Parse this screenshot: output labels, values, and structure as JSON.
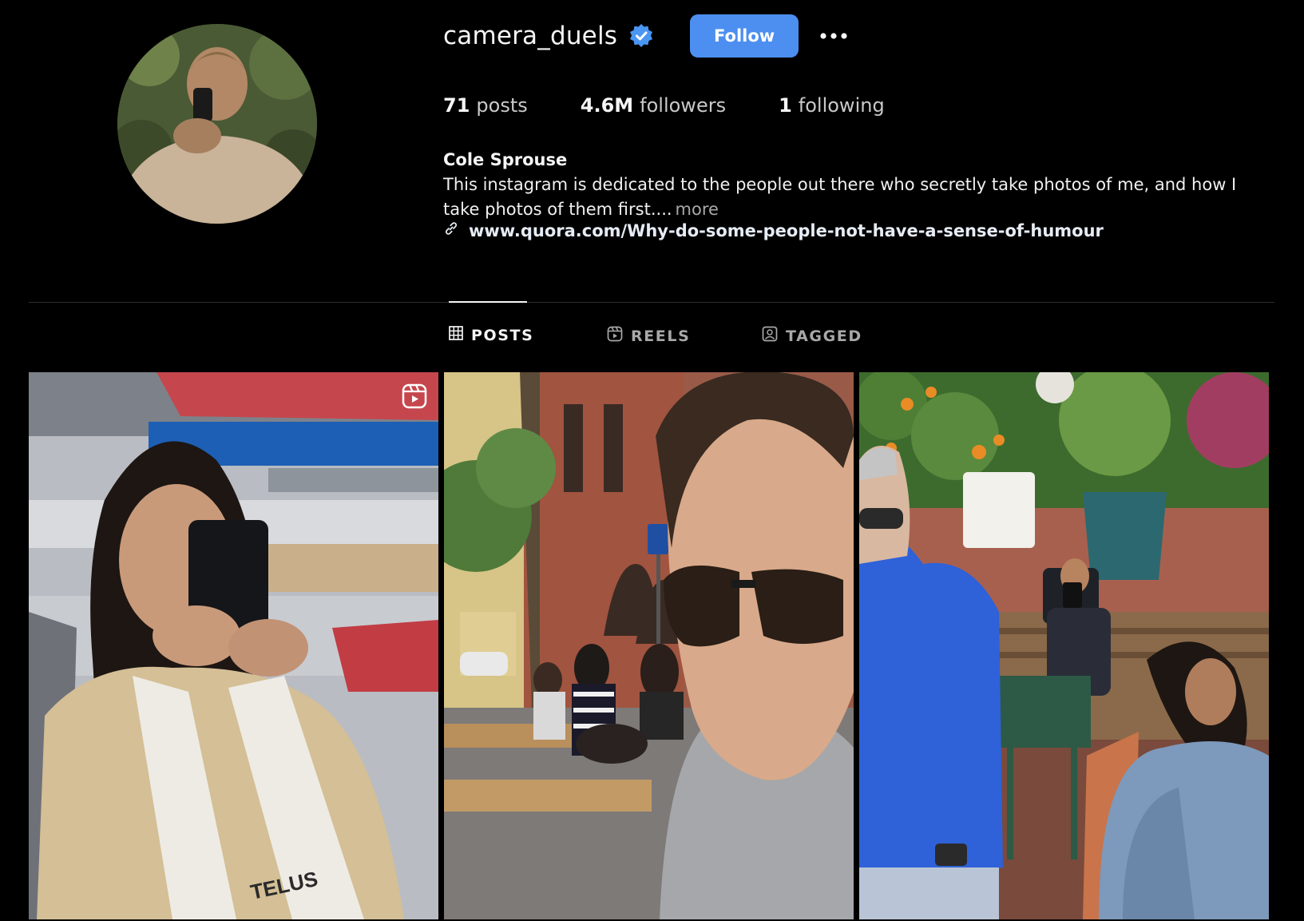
{
  "profile": {
    "username": "camera_duels",
    "verified": true,
    "follow_label": "Follow",
    "more_icon": "more-options-icon",
    "avatar_alt": "profile picture"
  },
  "stats": {
    "posts_count": "71",
    "posts_label": "posts",
    "followers_count": "4.6M",
    "followers_label": "followers",
    "following_count": "1",
    "following_label": "following"
  },
  "bio": {
    "full_name": "Cole Sprouse",
    "text": "This instagram is dedicated to the people out there who secretly take photos of me, and how I take photos of them first....",
    "more_label": "more",
    "link": "www.quora.com/Why-do-some-people-not-have-a-sense-of-humour",
    "link_icon": "link-icon"
  },
  "tabs": [
    {
      "label": "POSTS",
      "icon": "grid-icon",
      "active": true
    },
    {
      "label": "REELS",
      "icon": "reels-icon",
      "active": false
    },
    {
      "label": "TAGGED",
      "icon": "tagged-icon",
      "active": false
    }
  ],
  "posts": [
    {
      "type": "reel",
      "icon": "reel-badge-icon"
    },
    {
      "type": "photo"
    },
    {
      "type": "photo"
    }
  ],
  "colors": {
    "background": "#000000",
    "accent": "#4c8ff0",
    "verified_badge": "#4a96f2",
    "muted_text": "#a8a8a8"
  }
}
